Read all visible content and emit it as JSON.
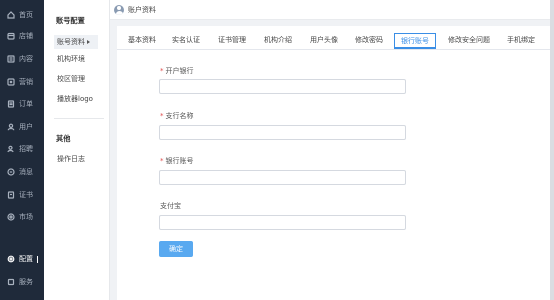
{
  "nav": {
    "items": [
      {
        "label": "首页",
        "icon": "home-icon"
      },
      {
        "label": "店铺",
        "icon": "store-icon"
      },
      {
        "label": "内容",
        "icon": "content-icon"
      },
      {
        "label": "营销",
        "icon": "marketing-icon"
      },
      {
        "label": "订单",
        "icon": "order-icon"
      },
      {
        "label": "用户",
        "icon": "user-icon"
      },
      {
        "label": "招聘",
        "icon": "recruit-icon"
      },
      {
        "label": "消息",
        "icon": "message-icon"
      },
      {
        "label": "证书",
        "icon": "certificate-icon"
      },
      {
        "label": "市场",
        "icon": "market-icon"
      },
      {
        "label": "配置",
        "icon": "settings-icon"
      },
      {
        "label": "服务",
        "icon": "service-icon"
      }
    ]
  },
  "subnav": {
    "section1": "账号配置",
    "items1": [
      "账号资料",
      "机构环境",
      "校区管理",
      "播放器logo"
    ],
    "section2": "其他",
    "items2": [
      "操作日志"
    ]
  },
  "header": {
    "title": "账户资料"
  },
  "tabs": [
    "基本资料",
    "实名认证",
    "证书管理",
    "机构介绍",
    "用户头像",
    "修改密码",
    "银行账号",
    "修改安全问题",
    "手机绑定"
  ],
  "form": {
    "bank_label": "开户银行",
    "branch_label": "支行名称",
    "account_label": "银行账号",
    "alipay_label": "支付宝",
    "required_mark": "*",
    "submit_label": "确定"
  },
  "colors": {
    "nav_bg": "#1f2a3a",
    "accent": "#3a8ee6",
    "button": "#59a9f0",
    "required": "#e04b4b"
  }
}
